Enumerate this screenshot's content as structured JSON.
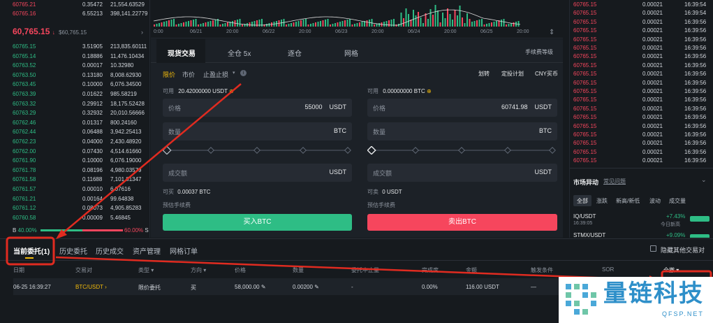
{
  "order_book": {
    "asks_top": [
      {
        "price": "60765.21",
        "qty": "0.35472",
        "total": "21,554.63529"
      },
      {
        "price": "60765.16",
        "qty": "6.55213",
        "total": "398,141.22779"
      }
    ],
    "last_price": "60,765.15",
    "last_price_alt": "$60,765.15",
    "bids": [
      {
        "price": "60765.15",
        "qty": "3.51905",
        "total": "213,835.60111"
      },
      {
        "price": "60765.14",
        "qty": "0.18886",
        "total": "11,476.10434"
      },
      {
        "price": "60763.52",
        "qty": "0.00017",
        "total": "10.32980"
      },
      {
        "price": "60763.50",
        "qty": "0.13180",
        "total": "8,008.62930"
      },
      {
        "price": "60763.45",
        "qty": "0.10000",
        "total": "6,076.34500"
      },
      {
        "price": "60763.39",
        "qty": "0.01622",
        "total": "985.58219"
      },
      {
        "price": "60763.32",
        "qty": "0.29912",
        "total": "18,175.52428"
      },
      {
        "price": "60763.29",
        "qty": "0.32932",
        "total": "20,010.56666"
      },
      {
        "price": "60762.46",
        "qty": "0.01317",
        "total": "800.24160"
      },
      {
        "price": "60762.44",
        "qty": "0.06488",
        "total": "3,942.25413"
      },
      {
        "price": "60762.23",
        "qty": "0.04000",
        "total": "2,430.48920"
      },
      {
        "price": "60762.00",
        "qty": "0.07430",
        "total": "4,514.61660"
      },
      {
        "price": "60761.90",
        "qty": "0.10000",
        "total": "6,076.19000"
      },
      {
        "price": "60761.78",
        "qty": "0.08196",
        "total": "4,980.03579"
      },
      {
        "price": "60761.58",
        "qty": "0.11688",
        "total": "7,101.81347"
      },
      {
        "price": "60761.57",
        "qty": "0.00010",
        "total": "6.07616"
      },
      {
        "price": "60761.21",
        "qty": "0.00164",
        "total": "99.64838"
      },
      {
        "price": "60761.12",
        "qty": "0.08073",
        "total": "4,905.85283"
      },
      {
        "price": "60760.58",
        "qty": "0.00009",
        "total": "5.46845"
      }
    ],
    "ratio_buy_label": "B",
    "ratio_buy": "40.00%",
    "ratio_sell": "60.00%",
    "ratio_sell_label": "S"
  },
  "chart": {
    "time_labels": [
      "0:00",
      "06/21",
      "20:00",
      "06/22",
      "20:00",
      "06/23",
      "20:00",
      "06/24",
      "20:00",
      "06/25",
      "20:00"
    ]
  },
  "trade": {
    "tabs": [
      "现货交易",
      "全仓 5x",
      "逐仓",
      "网格"
    ],
    "fee_level": "手续费等级",
    "order_types": [
      "限价",
      "市价",
      "止盈止损"
    ],
    "links": [
      "划转",
      "定投计划",
      "CNY买币"
    ],
    "buy": {
      "available_label": "可用",
      "available": "20.42000000 USDT",
      "price_label": "价格",
      "price": "55000",
      "price_unit": "USDT",
      "qty_label": "数量",
      "qty_unit": "BTC",
      "amount_label": "成交额",
      "amount_unit": "USDT",
      "can_buy_label": "可买",
      "can_buy": "0.00037 BTC",
      "fee_label": "预估手续费",
      "button": "买入BTC"
    },
    "sell": {
      "available_label": "可用",
      "available": "0.00000000 BTC",
      "price_label": "价格",
      "price": "60741.98",
      "price_unit": "USDT",
      "qty_label": "数量",
      "qty_unit": "BTC",
      "amount_label": "成交额",
      "amount_unit": "USDT",
      "can_sell_label": "可卖",
      "can_sell": "0 USDT",
      "fee_label": "预估手续费",
      "button": "卖出BTC"
    }
  },
  "trades": {
    "rows": [
      {
        "price": "60765.15",
        "qty": "0.00021",
        "time": "16:39:54"
      },
      {
        "price": "60765.15",
        "qty": "0.00021",
        "time": "16:39:54"
      },
      {
        "price": "60765.15",
        "qty": "0.00021",
        "time": "16:39:56"
      },
      {
        "price": "60765.15",
        "qty": "0.00021",
        "time": "16:39:56"
      },
      {
        "price": "60765.15",
        "qty": "0.00021",
        "time": "16:39:56"
      },
      {
        "price": "60765.15",
        "qty": "0.00021",
        "time": "16:39:56"
      },
      {
        "price": "60765.15",
        "qty": "0.00021",
        "time": "16:39:56"
      },
      {
        "price": "60765.15",
        "qty": "0.00021",
        "time": "16:39:56"
      },
      {
        "price": "60765.15",
        "qty": "0.00021",
        "time": "16:39:56"
      },
      {
        "price": "60765.15",
        "qty": "0.00021",
        "time": "16:39:56"
      },
      {
        "price": "60765.15",
        "qty": "0.00021",
        "time": "16:39:56"
      },
      {
        "price": "60765.15",
        "qty": "0.00021",
        "time": "16:39:56"
      },
      {
        "price": "60765.15",
        "qty": "0.00021",
        "time": "16:39:56"
      },
      {
        "price": "60765.15",
        "qty": "0.00021",
        "time": "16:39:56"
      },
      {
        "price": "60765.15",
        "qty": "0.00021",
        "time": "16:39:56"
      },
      {
        "price": "60765.15",
        "qty": "0.00021",
        "time": "16:39:56"
      },
      {
        "price": "60765.15",
        "qty": "0.00021",
        "time": "16:39:56"
      },
      {
        "price": "60765.15",
        "qty": "0.00021",
        "time": "16:39:56"
      },
      {
        "price": "60765.15",
        "qty": "0.00021",
        "time": "16:39:56"
      }
    ]
  },
  "market_moves": {
    "title": "市场异动",
    "faq": "常见问题",
    "tabs": [
      "全部",
      "涨跌",
      "新高/新低",
      "波动",
      "成交量"
    ],
    "items": [
      {
        "pair": "IQ/USDT",
        "time": "16:39:05",
        "change": "+7.43%",
        "note": "今日新高"
      },
      {
        "pair": "STMX/USDT",
        "time": "",
        "change": "+9.09%",
        "note": ""
      }
    ]
  },
  "orders": {
    "tabs": [
      "当前委托(1)",
      "历史委托",
      "历史成交",
      "资产管理",
      "网格订单"
    ],
    "hide_others": "隐藏其他交易对",
    "headers": [
      "日期",
      "交易对",
      "类型",
      "方向",
      "价格",
      "数量",
      "委托中止量",
      "完成度",
      "金额",
      "触发条件",
      "SOR",
      "全撤"
    ],
    "row": {
      "date": "06-25 16:39:27",
      "pair": "BTC/USDT",
      "type": "限价委托",
      "side": "买",
      "price": "58,000.00",
      "qty": "0.00200",
      "iceberg": "-",
      "filled": "0.00%",
      "amount": "116.00 USDT",
      "trigger": "—"
    }
  },
  "watermark": {
    "text": "量链科技",
    "sub": "QFSP.NET"
  },
  "colors": {
    "buy": "#2ebd85",
    "sell": "#f6465d",
    "accent": "#f0b90b",
    "annotation": "#e02b20"
  }
}
